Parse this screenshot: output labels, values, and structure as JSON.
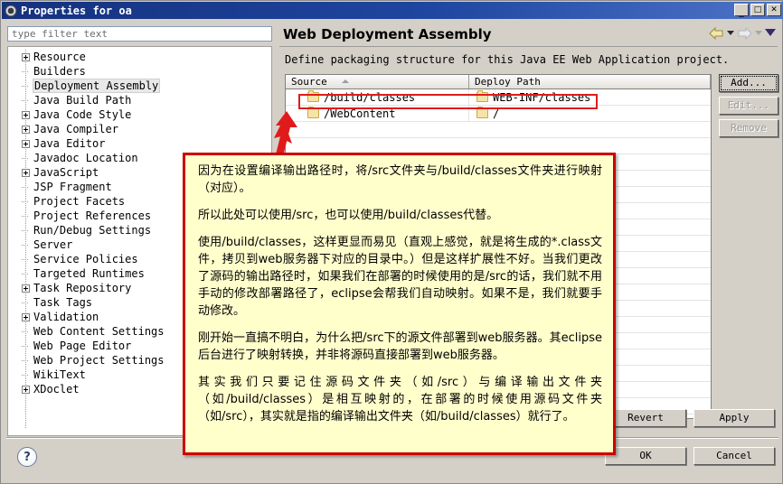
{
  "window": {
    "title": "Properties for oa",
    "icon": "gear-icon",
    "controls": {
      "minimize": "_",
      "maximize": "□",
      "close": "✕"
    }
  },
  "filter": {
    "placeholder": "type filter text",
    "value": ""
  },
  "tree": {
    "items": [
      {
        "label": "Resource",
        "expandable": true,
        "selected": false
      },
      {
        "label": "Builders",
        "expandable": false,
        "selected": false
      },
      {
        "label": "Deployment Assembly",
        "expandable": false,
        "selected": true
      },
      {
        "label": "Java Build Path",
        "expandable": false,
        "selected": false
      },
      {
        "label": "Java Code Style",
        "expandable": true,
        "selected": false
      },
      {
        "label": "Java Compiler",
        "expandable": true,
        "selected": false
      },
      {
        "label": "Java Editor",
        "expandable": true,
        "selected": false
      },
      {
        "label": "Javadoc Location",
        "expandable": false,
        "selected": false
      },
      {
        "label": "JavaScript",
        "expandable": true,
        "selected": false
      },
      {
        "label": "JSP Fragment",
        "expandable": false,
        "selected": false
      },
      {
        "label": "Project Facets",
        "expandable": false,
        "selected": false
      },
      {
        "label": "Project References",
        "expandable": false,
        "selected": false
      },
      {
        "label": "Run/Debug Settings",
        "expandable": false,
        "selected": false
      },
      {
        "label": "Server",
        "expandable": false,
        "selected": false
      },
      {
        "label": "Service Policies",
        "expandable": false,
        "selected": false
      },
      {
        "label": "Targeted Runtimes",
        "expandable": false,
        "selected": false
      },
      {
        "label": "Task Repository",
        "expandable": true,
        "selected": false
      },
      {
        "label": "Task Tags",
        "expandable": false,
        "selected": false
      },
      {
        "label": "Validation",
        "expandable": true,
        "selected": false
      },
      {
        "label": "Web Content Settings",
        "expandable": false,
        "selected": false
      },
      {
        "label": "Web Page Editor",
        "expandable": false,
        "selected": false
      },
      {
        "label": "Web Project Settings",
        "expandable": false,
        "selected": false
      },
      {
        "label": "WikiText",
        "expandable": false,
        "selected": false
      },
      {
        "label": "XDoclet",
        "expandable": true,
        "selected": false
      }
    ]
  },
  "page": {
    "title": "Web Deployment Assembly",
    "description": "Define packaging structure for this Java EE Web Application project.",
    "nav": {
      "back_icon": "back-arrow-icon",
      "back_menu_icon": "chevron-down-icon",
      "forward_icon": "forward-arrow-icon",
      "forward_menu_icon": "chevron-down-icon",
      "menu_icon": "chevron-down-icon"
    }
  },
  "table": {
    "columns": [
      "Source",
      "Deploy Path"
    ],
    "sort_column": "Source",
    "sort_direction": "asc",
    "rows": [
      {
        "source": "/build/classes",
        "deploy_path": "WEB-INF/classes",
        "highlighted": true
      },
      {
        "source": "/WebContent",
        "deploy_path": "/",
        "highlighted": false
      }
    ],
    "empty_rows": 19
  },
  "side_buttons": [
    {
      "label": "Add...",
      "enabled": true,
      "focused": true,
      "name": "add-button"
    },
    {
      "label": "Edit...",
      "enabled": false,
      "focused": false,
      "name": "edit-button"
    },
    {
      "label": "Remove",
      "enabled": false,
      "focused": false,
      "name": "remove-button"
    }
  ],
  "footer": {
    "revert_label": "Revert",
    "apply_label": "Apply",
    "ok_label": "OK",
    "cancel_label": "Cancel",
    "help_label": "?"
  },
  "annotation": {
    "highlight_row": "/build/classes",
    "arrow_icon": "red-arrow-icon",
    "border_color": "#cc0000",
    "background_color": "#ffffcc",
    "paragraphs": [
      "因为在设置编译输出路径时，将/src文件夹与/build/classes文件夹进行映射（对应）。",
      "所以此处可以使用/src，也可以使用/build/classes代替。",
      "使用/build/classes，这样更显而易见（直观上感觉，就是将生成的*.class文件，拷贝到web服务器下对应的目录中。）但是这样扩展性不好。当我们更改了源码的输出路径时，如果我们在部署的时候使用的是/src的话，我们就不用手动的修改部署路径了，eclipse会帮我们自动映射。如果不是，我们就要手动修改。",
      "刚开始一直搞不明白，为什么把/src下的源文件部署到web服务器。其eclipse后台进行了映射转换，并非将源码直接部署到web服务器。",
      "其实我们只要记住源码文件夹（如/src）与编译输出文件夹（如/build/classes）是相互映射的，在部署的时候使用源码文件夹（如/src），其实就是指的编译输出文件夹（如/build/classes）就行了。"
    ]
  }
}
